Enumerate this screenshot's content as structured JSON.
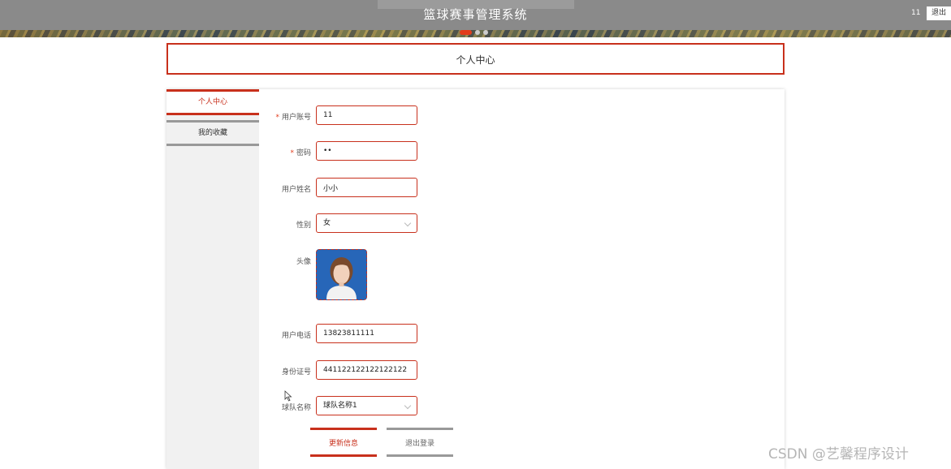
{
  "header": {
    "site_title": "篮球赛事管理系统",
    "username": "11",
    "logout_label": "退出",
    "carousel_active_index": 0
  },
  "page": {
    "title": "个人中心"
  },
  "sidebar": {
    "items": [
      {
        "label": "个人中心",
        "active": true
      },
      {
        "label": "我的收藏",
        "active": false
      }
    ]
  },
  "form": {
    "account": {
      "label": "用户账号",
      "required": true,
      "value": "11"
    },
    "password": {
      "label": "密码",
      "required": true,
      "value": "••"
    },
    "name": {
      "label": "用户姓名",
      "value": "小小"
    },
    "gender": {
      "label": "性别",
      "value": "女"
    },
    "avatar": {
      "label": "头像"
    },
    "phone": {
      "label": "用户电话",
      "value": "13823811111"
    },
    "id_number": {
      "label": "身份证号",
      "value": "441122122122122122"
    },
    "team": {
      "label": "球队名称",
      "value": "球队名称1"
    },
    "required_mark": "*"
  },
  "actions": {
    "update_label": "更新信息",
    "logout_label": "退出登录"
  },
  "watermark": "CSDN @艺馨程序设计",
  "colors": {
    "accent": "#c8301c",
    "topbar": "#8a8a8a",
    "sidebar_bg": "#f1f1f1"
  }
}
